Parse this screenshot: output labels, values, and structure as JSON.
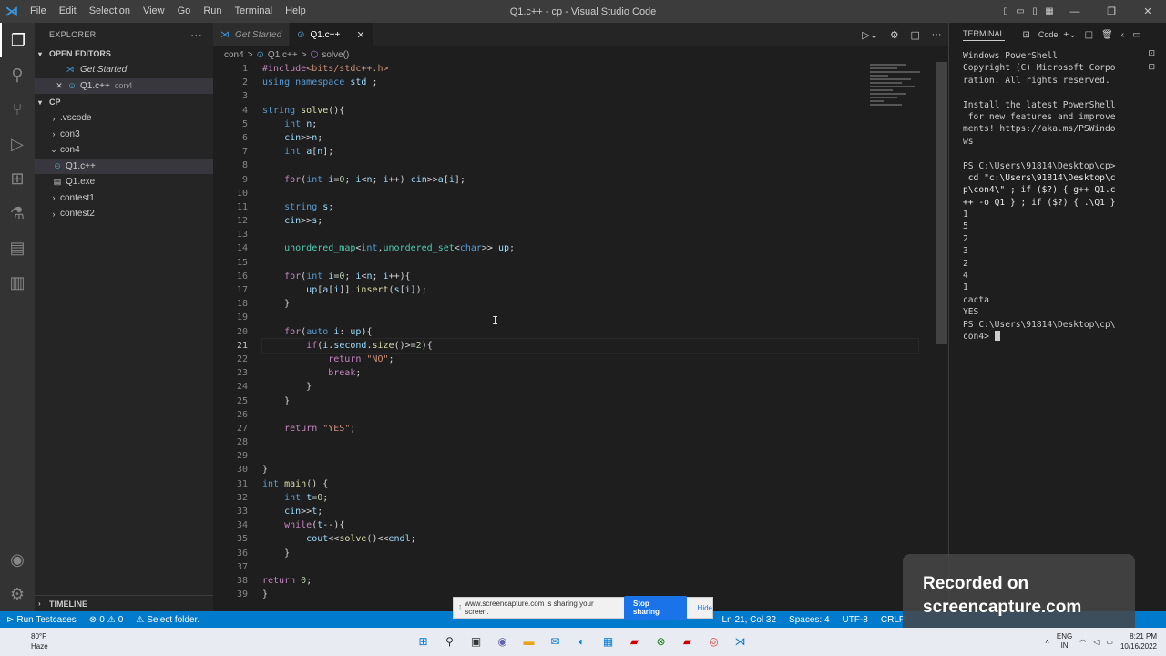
{
  "window": {
    "title": "Q1.c++ - cp - Visual Studio Code",
    "menu": [
      "File",
      "Edit",
      "Selection",
      "View",
      "Go",
      "Run",
      "Terminal",
      "Help"
    ]
  },
  "sidebar": {
    "header": "EXPLORER",
    "open_editors_label": "OPEN EDITORS",
    "open_editors": [
      {
        "name": "Get Started",
        "sub": ""
      },
      {
        "name": "Q1.c++",
        "sub": "con4"
      }
    ],
    "folder_label": "CP",
    "tree": [
      {
        "name": ".vscode"
      },
      {
        "name": "con3"
      },
      {
        "name": "con4"
      },
      {
        "name": "Q1.c++"
      },
      {
        "name": "Q1.exe"
      },
      {
        "name": "contest1"
      },
      {
        "name": "contest2"
      }
    ],
    "timeline_label": "TIMELINE"
  },
  "tabs": [
    {
      "label": "Get Started"
    },
    {
      "label": "Q1.c++"
    }
  ],
  "breadcrumb": [
    "con4",
    ">",
    "Q1.c++",
    ">",
    "solve()"
  ],
  "editor": {
    "current_line": 21,
    "lines": [
      "#include<bits/stdc++.h>",
      "using namespace std ;",
      "",
      "string solve(){",
      "    int n;",
      "    cin>>n;",
      "    int a[n];",
      "",
      "    for(int i=0; i<n; i++) cin>>a[i];",
      "",
      "    string s;",
      "    cin>>s;",
      "",
      "    unordered_map<int,unordered_set<char>> up;",
      "",
      "    for(int i=0; i<n; i++){",
      "        up[a[i]].insert(s[i]);",
      "    }",
      "",
      "    for(auto i: up){",
      "        if(i.second.size()>=2){",
      "            return \"NO\";",
      "            break;",
      "        }",
      "    }",
      "",
      "    return \"YES\";",
      "",
      "",
      "}",
      "int main() {",
      "    int t=0;",
      "    cin>>t;",
      "    while(t--){",
      "        cout<<solve()<<endl;",
      "    }",
      "",
      "return 0;",
      "}"
    ]
  },
  "terminal": {
    "tab_label": "TERMINAL",
    "shell_label": "Code",
    "lines": [
      "Windows PowerShell",
      "Copyright (C) Microsoft Corpo",
      "ration. All rights reserved.",
      "",
      "Install the latest PowerShell",
      " for new features and improve",
      "ments! https://aka.ms/PSWindo",
      "ws",
      "",
      "PS C:\\Users\\91814\\Desktop\\cp>",
      " cd \"c:\\Users\\91814\\Desktop\\c",
      "p\\con4\\\" ; if ($?) { g++ Q1.c",
      "++ -o Q1 } ; if ($?) { .\\Q1 }",
      "1",
      "5",
      "2",
      "3",
      "2",
      "4",
      "1",
      "cacta",
      "YES",
      "PS C:\\Users\\91814\\Desktop\\cp\\",
      "con4> "
    ]
  },
  "statusbar": {
    "run_testcases": "Run Testcases",
    "problems": "0",
    "warnings": "0",
    "select_folder": "Select folder.",
    "position": "Ln 21, Col 32",
    "spaces": "Spaces: 4",
    "encoding": "UTF-8",
    "eol": "CRLF"
  },
  "share_bar": {
    "message": "www.screencapture.com is sharing your screen.",
    "stop_label": "Stop sharing",
    "hide_label": "Hide"
  },
  "watermark": {
    "line1": "Recorded on",
    "line2": "screencapture.com"
  },
  "taskbar": {
    "weather_temp": "80°F",
    "weather_desc": "Haze",
    "lang_top": "ENG",
    "lang_bottom": "IN",
    "time": "8:21 PM",
    "date": "10/16/2022"
  },
  "colors": {
    "accent": "#007acc",
    "keyword": "#569cd6",
    "control": "#c586c0",
    "string": "#ce9178",
    "function": "#dcdcaa",
    "type": "#4ec9b0"
  }
}
